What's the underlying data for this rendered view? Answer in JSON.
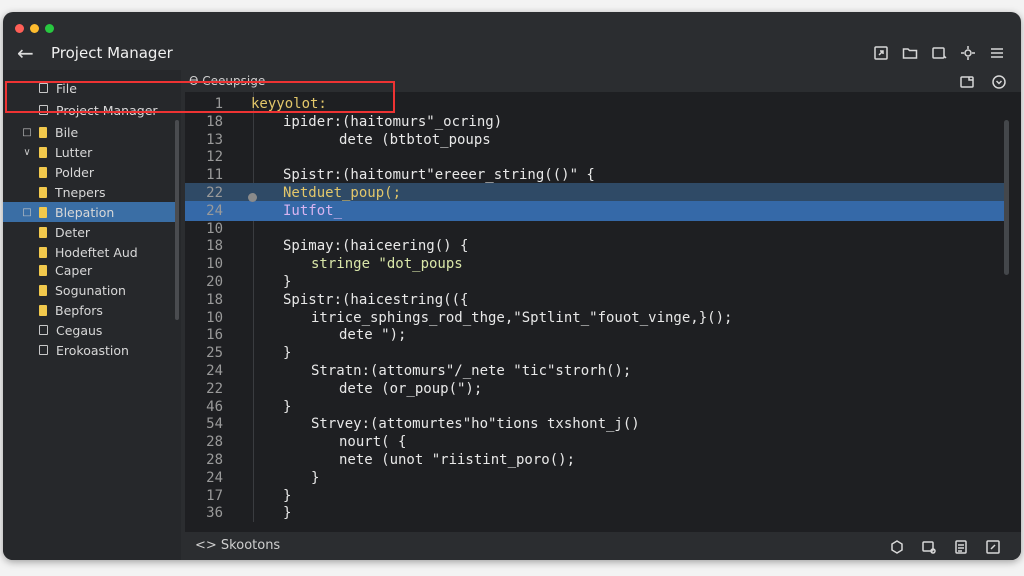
{
  "window": {
    "title": "Project Manager",
    "traffic_colors": [
      "#ff5f57",
      "#febc2e",
      "#28c840"
    ]
  },
  "toolbar_icons": [
    "export-icon",
    "folder-icon",
    "window-icon",
    "settings-icon",
    "menu-icon"
  ],
  "sidebar": {
    "items": [
      {
        "label": "File",
        "icon": "doc-icon",
        "arrow": ""
      },
      {
        "label": "Project Manager",
        "icon": "doc-icon",
        "arrow": ""
      },
      {
        "label": "Bile",
        "icon": "folder-icon",
        "arrow": "□"
      },
      {
        "label": "Lutter",
        "icon": "folder-icon",
        "arrow": "∨"
      },
      {
        "label": "Polder",
        "icon": "folder-icon",
        "arrow": ""
      },
      {
        "label": "Tnepers",
        "icon": "folder-icon",
        "arrow": ""
      },
      {
        "label": "Blepation",
        "icon": "folder-icon",
        "arrow": "□"
      },
      {
        "label": "Deter",
        "icon": "folder-icon",
        "arrow": ""
      },
      {
        "label": "Hodeftet Aud",
        "icon": "folder-icon",
        "arrow": ""
      },
      {
        "label": "Caper",
        "icon": "folder-icon",
        "arrow": ""
      },
      {
        "label": "Sogunation",
        "icon": "folder-icon",
        "arrow": ""
      },
      {
        "label": "Bepfors",
        "icon": "folder-icon",
        "arrow": ""
      },
      {
        "label": "Cegaus",
        "icon": "doc-icon",
        "arrow": ""
      },
      {
        "label": "Erokoastion",
        "icon": "monitor-icon",
        "arrow": ""
      }
    ]
  },
  "editor": {
    "tab_label": "Ɵ Ceeupsige",
    "lines": [
      {
        "num": "1",
        "text": "keyyolot:",
        "color": "yellow"
      },
      {
        "num": "18",
        "text": "ipider:(haitomurs\"_ocring)",
        "color": "white"
      },
      {
        "num": "13",
        "text": "dete (btbtot_poups",
        "color": "white"
      },
      {
        "num": "12",
        "text": "",
        "color": "white"
      },
      {
        "num": "11",
        "text": "Spistr:(haitomurt\"ereeer_string(()\" {",
        "color": "white"
      },
      {
        "num": "22",
        "text": "Netduet_poup(;",
        "color": "yellow"
      },
      {
        "num": "24",
        "text": "Iutfot_",
        "color": "purple"
      },
      {
        "num": "10",
        "text": "",
        "color": "white"
      },
      {
        "num": "18",
        "text": "Spimay:(haiceering() {",
        "color": "white"
      },
      {
        "num": "10",
        "text": "stringe \"dot_poups",
        "color": "green"
      },
      {
        "num": "20",
        "text": "}",
        "color": "white"
      },
      {
        "num": "18",
        "text": "Spistr:(haicestring(({",
        "color": "white"
      },
      {
        "num": "10",
        "text": "itrice_sphings_rod_thge,\"Sptlint_\"fouot_vinge,}();",
        "color": "white"
      },
      {
        "num": "16",
        "text": "dete \");",
        "color": "white"
      },
      {
        "num": "25",
        "text": "}",
        "color": "white"
      },
      {
        "num": "24",
        "text": "Stratn:(attomurs\"/_nete \"tic\"strorh();",
        "color": "white"
      },
      {
        "num": "22",
        "text": "dete (or_poup(\");",
        "color": "white"
      },
      {
        "num": "46",
        "text": "}",
        "color": "white"
      },
      {
        "num": "54",
        "text": "Strvey:(attomurtes\"ho\"tions txshont_j()",
        "color": "white"
      },
      {
        "num": "28",
        "text": "nourt( {",
        "color": "white"
      },
      {
        "num": "28",
        "text": "nete (unot \"riistint_poro();",
        "color": "white"
      },
      {
        "num": "24",
        "text": "}",
        "color": "white"
      },
      {
        "num": "17",
        "text": "}",
        "color": "white"
      },
      {
        "num": "36",
        "text": "}",
        "color": "white"
      }
    ]
  },
  "status": {
    "label": "Skootons"
  }
}
